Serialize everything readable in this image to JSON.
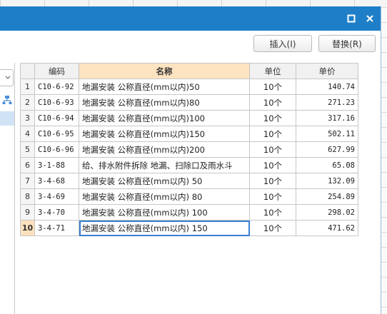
{
  "toolbar": {
    "insert_label": "插入(I)",
    "replace_label": "替换(R)"
  },
  "table": {
    "headers": [
      "",
      "编码",
      "名称",
      "单位",
      "单价"
    ],
    "rows": [
      {
        "n": "1",
        "code": "C10-6-92",
        "name": "地漏安装 公称直径(mm以内)50",
        "unit": "10个",
        "price": "140.74"
      },
      {
        "n": "2",
        "code": "C10-6-93",
        "name": "地漏安装 公称直径(mm以内)80",
        "unit": "10个",
        "price": "271.23"
      },
      {
        "n": "3",
        "code": "C10-6-94",
        "name": "地漏安装 公称直径(mm以内)100",
        "unit": "10个",
        "price": "317.16"
      },
      {
        "n": "4",
        "code": "C10-6-95",
        "name": "地漏安装 公称直径(mm以内)150",
        "unit": "10个",
        "price": "502.11"
      },
      {
        "n": "5",
        "code": "C10-6-96",
        "name": "地漏安装 公称直径(mm以内)200",
        "unit": "10个",
        "price": "627.99"
      },
      {
        "n": "6",
        "code": "3-1-88",
        "name": "给、排水附件拆除 地漏、扫除口及雨水斗",
        "unit": "10个",
        "price": "65.08"
      },
      {
        "n": "7",
        "code": "3-4-68",
        "name": "地漏安装 公称直径(mm以内) 50",
        "unit": "10个",
        "price": "132.09"
      },
      {
        "n": "8",
        "code": "3-4-69",
        "name": "地漏安装 公称直径(mm以内) 80",
        "unit": "10个",
        "price": "254.89"
      },
      {
        "n": "9",
        "code": "3-4-70",
        "name": "地漏安装 公称直径(mm以内) 100",
        "unit": "10个",
        "price": "298.02"
      },
      {
        "n": "10",
        "code": "3-4-71",
        "name": "地漏安装 公称直径(mm以内) 150",
        "unit": "10个",
        "price": "471.62"
      }
    ],
    "active_row": "10"
  },
  "icons": {
    "maximize": "maximize-icon",
    "close": "close-icon",
    "dropdown": "chevron-down-icon",
    "tree": "tree-icon"
  },
  "colors": {
    "titlebar": "#1e7fc8",
    "header_highlight": "#fde3c0",
    "selection": "#3b7fd1"
  }
}
